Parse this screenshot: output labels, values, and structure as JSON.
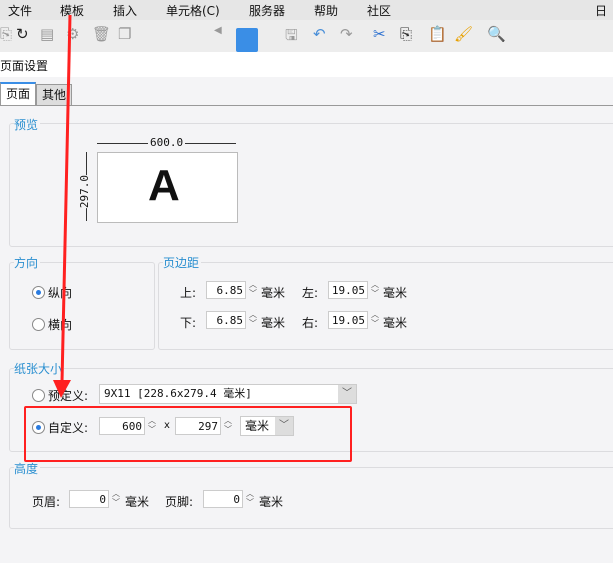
{
  "menu": [
    "文件",
    "模板",
    "插入",
    "单元格(C)",
    "服务器",
    "帮助",
    "社区",
    "日志"
  ],
  "dialog_title": "页面设置",
  "tabs": [
    "页面",
    "其他"
  ],
  "preview": {
    "label": "预览",
    "width": "600.0",
    "height": "297.0",
    "letter": "A"
  },
  "orientation": {
    "label": "方向",
    "portrait": "纵向",
    "landscape": "横向"
  },
  "margins": {
    "label": "页边距",
    "top_label": "上:",
    "top": "6.85",
    "left_label": "左:",
    "left": "19.05",
    "bottom_label": "下:",
    "bottom": "6.85",
    "right_label": "右:",
    "right": "19.05",
    "unit": "毫米"
  },
  "paper": {
    "label": "纸张大小",
    "predefined_label": "预定义:",
    "predefined_value": "9X11 [228.6x279.4 毫米]",
    "custom_label": "自定义:",
    "custom_width": "600",
    "times": "x",
    "custom_height": "297",
    "unit": "毫米"
  },
  "height": {
    "label": "高度",
    "header_label": "页眉:",
    "header": "0",
    "footer_label": "页脚:",
    "footer": "0",
    "unit": "毫米"
  },
  "colors": {
    "accent": "#2a8fd0",
    "annotation": "#ff2020"
  }
}
